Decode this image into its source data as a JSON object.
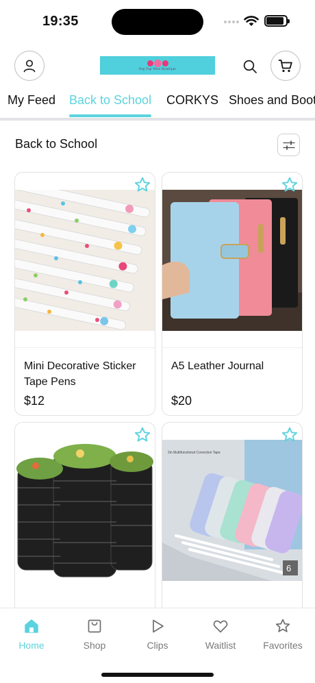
{
  "status": {
    "time": "19:35"
  },
  "brand": {
    "logo_text": "Pop Top Wow Boutique",
    "accent": "#5bd3de"
  },
  "header": {
    "profile_icon": "person-icon",
    "search_icon": "search-icon",
    "cart_icon": "cart-icon"
  },
  "tabs": [
    {
      "label": "My Feed",
      "active": false
    },
    {
      "label": "Back to School",
      "active": true
    },
    {
      "label": "CORKYS",
      "active": false
    },
    {
      "label": "Shoes and Boots",
      "active": false
    }
  ],
  "section": {
    "title": "Back to School",
    "filter_icon": "sliders-icon"
  },
  "products": [
    {
      "name": "Mini Decorative Sticker Tape Pens",
      "price": "$12",
      "image": "sticker-tape-pens-photo"
    },
    {
      "name": "A5 Leather Journal",
      "price": "$20",
      "image": "leather-journals-photo"
    },
    {
      "name": "",
      "price": "",
      "image": "meal-prep-containers-photo"
    },
    {
      "name": "",
      "price": "",
      "image": "correction-tape-set-photo",
      "image_text": "2in Multifunctional Correction Tape",
      "badge": "6"
    }
  ],
  "tabbar": [
    {
      "label": "Home",
      "icon": "home-icon",
      "active": true
    },
    {
      "label": "Shop",
      "icon": "bag-icon",
      "active": false
    },
    {
      "label": "Clips",
      "icon": "play-icon",
      "active": false
    },
    {
      "label": "Waitlist",
      "icon": "heart-icon",
      "active": false
    },
    {
      "label": "Favorites",
      "icon": "star-icon",
      "active": false
    }
  ]
}
